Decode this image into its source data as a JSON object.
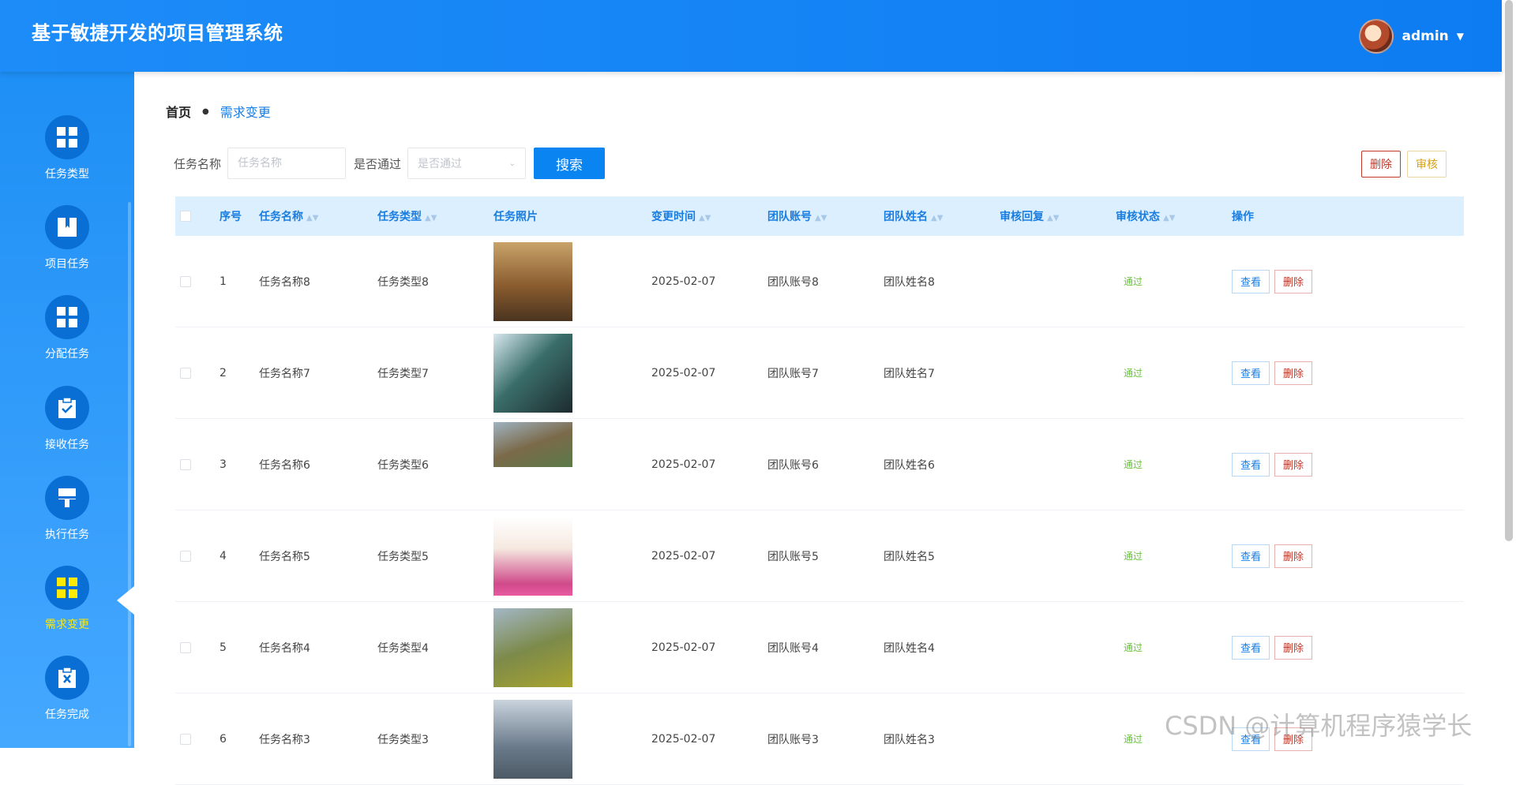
{
  "header": {
    "title": "基于敏捷开发的项目管理系统",
    "user": "admin"
  },
  "sidebar": {
    "items": [
      {
        "label": "任务类型",
        "icon": "grid-icon"
      },
      {
        "label": "项目任务",
        "icon": "book-icon"
      },
      {
        "label": "分配任务",
        "icon": "grid-icon"
      },
      {
        "label": "接收任务",
        "icon": "clipboard-check-icon"
      },
      {
        "label": "执行任务",
        "icon": "brush-icon"
      },
      {
        "label": "需求变更",
        "icon": "grid-icon",
        "active": true
      },
      {
        "label": "任务完成",
        "icon": "clipboard-x-icon"
      }
    ]
  },
  "breadcrumb": {
    "home": "首页",
    "current": "需求变更"
  },
  "search": {
    "task_name_label": "任务名称",
    "task_name_placeholder": "任务名称",
    "pass_label": "是否通过",
    "pass_placeholder": "是否通过",
    "search_button": "搜索"
  },
  "actions": {
    "delete": "删除",
    "audit": "审核"
  },
  "table": {
    "columns": [
      "序号",
      "任务名称",
      "任务类型",
      "任务照片",
      "变更时间",
      "团队账号",
      "团队姓名",
      "审核回复",
      "审核状态",
      "操作"
    ],
    "rows": [
      {
        "idx": "1",
        "name": "任务名称8",
        "type": "任务类型8",
        "time": "2025-02-07",
        "account": "团队账号8",
        "tname": "团队姓名8",
        "reply": "",
        "status": "通过"
      },
      {
        "idx": "2",
        "name": "任务名称7",
        "type": "任务类型7",
        "time": "2025-02-07",
        "account": "团队账号7",
        "tname": "团队姓名7",
        "reply": "",
        "status": "通过"
      },
      {
        "idx": "3",
        "name": "任务名称6",
        "type": "任务类型6",
        "time": "2025-02-07",
        "account": "团队账号6",
        "tname": "团队姓名6",
        "reply": "",
        "status": "通过"
      },
      {
        "idx": "4",
        "name": "任务名称5",
        "type": "任务类型5",
        "time": "2025-02-07",
        "account": "团队账号5",
        "tname": "团队姓名5",
        "reply": "",
        "status": "通过"
      },
      {
        "idx": "5",
        "name": "任务名称4",
        "type": "任务类型4",
        "time": "2025-02-07",
        "account": "团队账号4",
        "tname": "团队姓名4",
        "reply": "",
        "status": "通过"
      },
      {
        "idx": "6",
        "name": "任务名称3",
        "type": "任务类型3",
        "time": "2025-02-07",
        "account": "团队账号3",
        "tname": "团队姓名3",
        "reply": "",
        "status": "通过"
      }
    ],
    "view_button": "查看",
    "delete_button": "删除"
  },
  "watermark": "CSDN @计算机程序猿学长",
  "colors": {
    "primary": "#0a84f0",
    "active_menu_label": "#ffea00",
    "status_pass": "#67c23a",
    "delete": "#c0392b"
  }
}
